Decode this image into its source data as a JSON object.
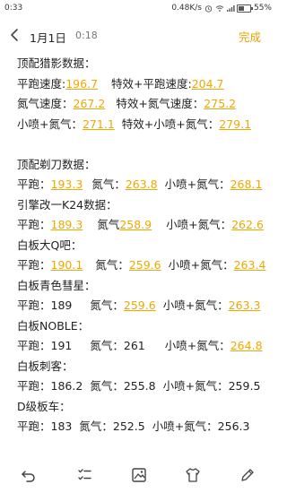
{
  "status": {
    "time": "0:33",
    "speed": "0.48K/s",
    "battery": "55%",
    "battery_level": 0.55,
    "icons": [
      "alarm-icon",
      "wifi-icon",
      "signal-icon",
      "battery-icon"
    ]
  },
  "nav": {
    "date": "1月1日",
    "time": "0:18",
    "done": "完成"
  },
  "note": {
    "title_liedaying": "顶配猎影数据：",
    "l1_label1": "平跑速度:",
    "l1_val1": "196.7",
    "l1_label2": "特效+平跑速度:",
    "l1_val2": "204.7",
    "l2_label1": "氮气速度：",
    "l2_val1": "267.2",
    "l2_label2": "特效+氮气速度：",
    "l2_val2": "275.2",
    "l3_label1": "小喷+氮气：",
    "l3_val1": "271.1",
    "l3_label2": "特效+小喷+氮气：",
    "l3_val2": "279.1",
    "title_tidao": "顶配剃刀数据：",
    "t1_label1": "平跑：",
    "t1_val1": "193.3",
    "t1_label2": "氮气：",
    "t1_val2": "263.8",
    "t1_label3": "小喷+氮气：",
    "t1_val3": "268.1",
    "title_k24": "引擎改一K24数据：",
    "k1_label1": "平跑：",
    "k1_val1": "189.3",
    "k1_label2": "氮气",
    "k1_val2": "258.9",
    "k1_label3": "小喷+氮气：",
    "k1_val3": "262.6",
    "title_daq": "白板大Q吧：",
    "q1_label1": "平跑：",
    "q1_val1": "190.1",
    "q1_label2": "氮气：",
    "q1_val2": "259.6",
    "q1_label3": "小喷+氮气：",
    "q1_val3": "263.4",
    "title_comet": "白板青色彗星：",
    "c1_label1": "平跑：",
    "c1_val1": "189",
    "c1_label2": "氮气：",
    "c1_val2": "259.6",
    "c1_label3": "小喷+氮气：",
    "c1_val3": "263.3",
    "title_noble": "白板NOBLE：",
    "n1_label1": "平跑：",
    "n1_val1": "191",
    "n1_label2": "氮气：",
    "n1_val2": "261",
    "n1_label3": "小喷+氮气：",
    "n1_val3": "264.8",
    "title_cike": "白板刺客：",
    "a1_label1": "平跑：",
    "a1_val1": "186.2",
    "a1_label2": "氮气：",
    "a1_val2": "255.8",
    "a1_label3": "小喷+氮气：",
    "a1_val3": "259.5",
    "title_dclass": "D级板车：",
    "d1_label1": "平跑：",
    "d1_val1": "183",
    "d1_label2": "氮气：",
    "d1_val2": "252.5",
    "d1_label3": "小喷+氮气：",
    "d1_val3": "256.3"
  },
  "toolbar": {
    "icons": [
      "undo-icon",
      "checklist-icon",
      "image-icon",
      "shirt-icon",
      "pen-icon"
    ]
  },
  "colors": {
    "accent": "#f0a800",
    "done": "#e6a400"
  }
}
